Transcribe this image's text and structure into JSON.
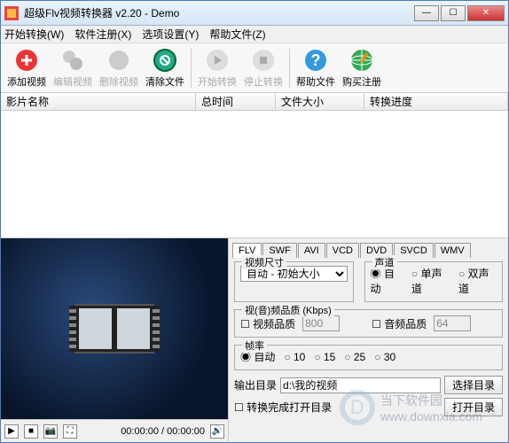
{
  "window": {
    "title": "超级Flv视频转换器 v2.20 - Demo"
  },
  "menu": {
    "start": "开始转换(W)",
    "register": "软件注册(X)",
    "options": "选项设置(Y)",
    "help": "帮助文件(Z)"
  },
  "toolbar": {
    "add": "添加视频",
    "edit": "编辑视频",
    "remove": "删除视频",
    "clear": "清除文件",
    "start": "开始转换",
    "stop": "停止转换",
    "help": "帮助文件",
    "buy": "购买注册"
  },
  "columns": {
    "name": "影片名称",
    "duration": "总时间",
    "size": "文件大小",
    "progress": "转换进度"
  },
  "player": {
    "time": "00:00:00 / 00:00:00"
  },
  "formats": {
    "tabs": [
      "FLV",
      "SWF",
      "AVI",
      "VCD",
      "DVD",
      "SVCD",
      "WMV"
    ],
    "active": "FLV"
  },
  "video_size": {
    "legend": "视频尺寸",
    "value": "自动 - 初始大小"
  },
  "audio_ch": {
    "legend": "声道",
    "opts": [
      "自动",
      "单声道",
      "双声道"
    ],
    "selected": "自动"
  },
  "quality": {
    "legend": "视(音)频品质 (Kbps)",
    "video_chk": "视频品质",
    "video_val": "800",
    "audio_chk": "音频品质",
    "audio_val": "64"
  },
  "fps": {
    "legend": "帧率",
    "opts": [
      "自动",
      "10",
      "15",
      "25",
      "30"
    ],
    "selected": "自动"
  },
  "output": {
    "label": "输出目录",
    "path": "d:\\我的视频",
    "browse": "选择目录"
  },
  "bottom": {
    "shutdown": "转换完成打开目录",
    "opendir": "打开目录"
  },
  "watermark": {
    "site": "当下软件园",
    "url": "www.downxia.com"
  }
}
